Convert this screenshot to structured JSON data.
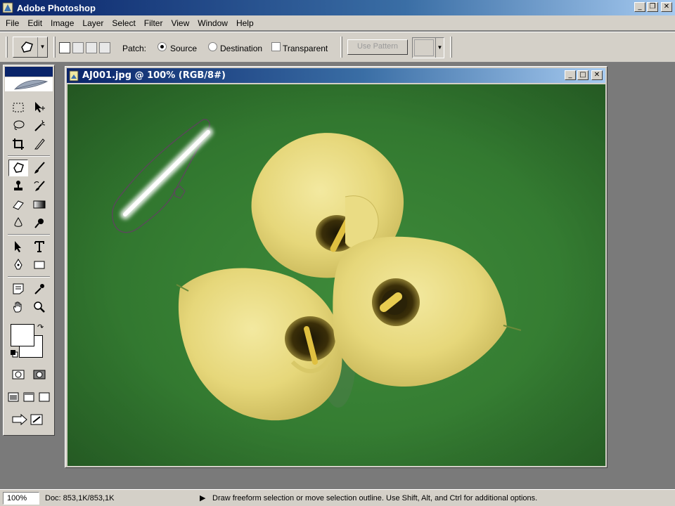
{
  "app": {
    "title": "Adobe Photoshop",
    "window_buttons": {
      "minimize": "_",
      "restore": "❐",
      "close": "✕"
    }
  },
  "menu": [
    "File",
    "Edit",
    "Image",
    "Layer",
    "Select",
    "Filter",
    "View",
    "Window",
    "Help"
  ],
  "options": {
    "tool_icon": "patch-tool-icon",
    "patch_label": "Patch:",
    "source_label": "Source",
    "destination_label": "Destination",
    "transparent_label": "Transparent",
    "patch_mode": "Source",
    "transparent_checked": false,
    "use_pattern_label": "Use Pattern",
    "use_pattern_enabled": false
  },
  "document": {
    "title": "AJ001.jpg @ 100% (RGB/8#)",
    "window_buttons": {
      "minimize": "_",
      "maximize": "□",
      "close": "✕"
    }
  },
  "toolbox": {
    "active_tool": "patch-tool",
    "foreground_color": "#ffffff",
    "background_color": "#ffffff"
  },
  "status": {
    "zoom": "100%",
    "doc_size": "Doc: 853,1K/853,1K",
    "message": "Draw freeform selection or move selection outline.  Use Shift, Alt, and Ctrl for additional options."
  },
  "colors": {
    "title_bar": "#0a246a",
    "chrome": "#d4d0c8",
    "workspace": "#7a7a7a",
    "canvas_green": "#357d32",
    "flower_yellow": "#e9dc82"
  }
}
